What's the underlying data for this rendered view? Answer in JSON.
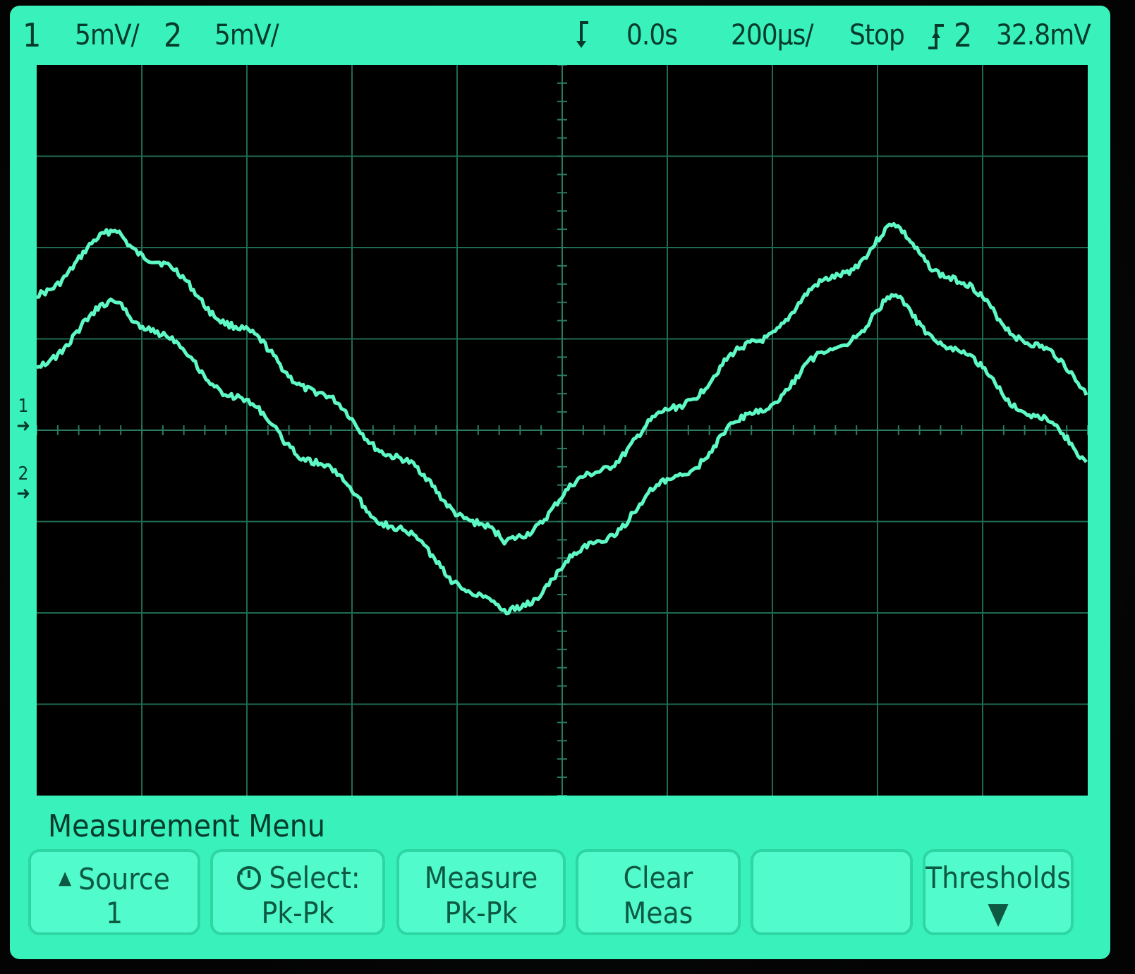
{
  "status": {
    "ch1_label": "1",
    "ch1_scale": "5mV/",
    "ch2_label": "2",
    "ch2_scale": "5mV/",
    "delay": "0.0s",
    "timebase": "200µs/",
    "run_state": "Stop",
    "trigger_source": "2",
    "trigger_level": "32.8mV",
    "trigger_mode_icon": "trigger-arrow-icon",
    "trigger_slope_icon": "rising-edge-icon"
  },
  "markers": {
    "ch1_ground": "1",
    "ch2_ground": "2"
  },
  "menu": {
    "title": "Measurement Menu",
    "softkeys": [
      {
        "line1": "Source",
        "line2": "1",
        "icon": "up-arrow-icon"
      },
      {
        "line1": "Select:",
        "line2": "Pk-Pk",
        "icon": "knob-icon"
      },
      {
        "line1": "Measure",
        "line2": "Pk-Pk"
      },
      {
        "line1": "Clear",
        "line2": "Meas"
      },
      {
        "line1": "",
        "line2": ""
      },
      {
        "line1": "Thresholds",
        "line2": "",
        "icon": "down-arrow-icon"
      }
    ]
  },
  "colors": {
    "screen": "#39f2bb",
    "trace": "#5ff9c6",
    "plot_background": "#000000"
  }
}
